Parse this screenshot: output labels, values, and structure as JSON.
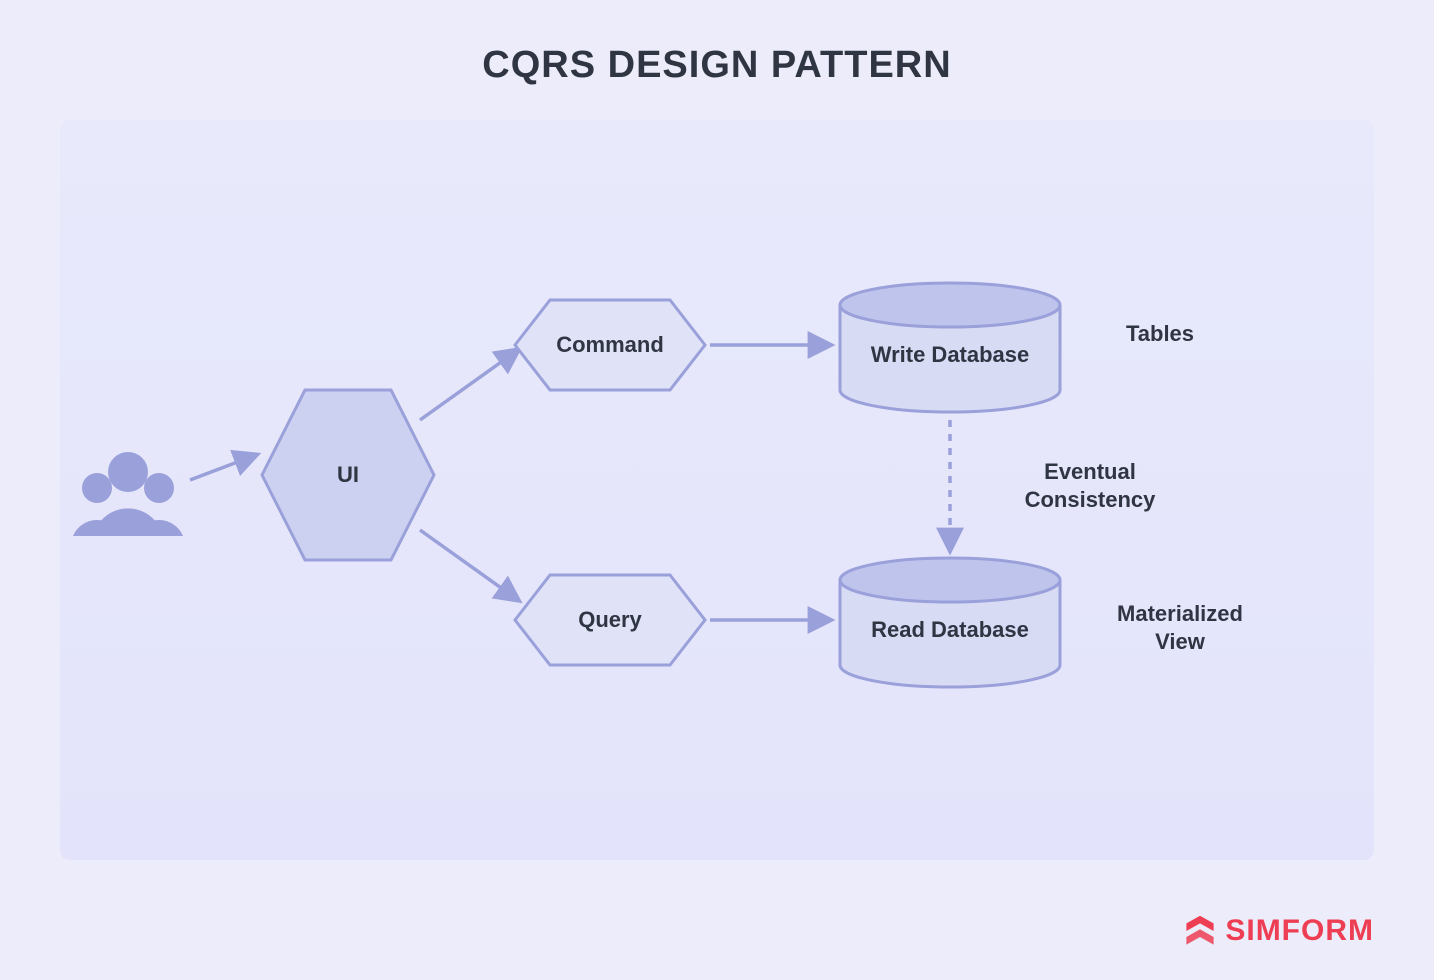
{
  "title": "CQRS DESIGN PATTERN",
  "nodes": {
    "ui": "UI",
    "command": "Command",
    "query": "Query",
    "write_db": "Write Database",
    "read_db": "Read Database"
  },
  "annotations": {
    "tables": "Tables",
    "eventual_line1": "Eventual",
    "eventual_line2": "Consistency",
    "mat_view_line1": "Materialized",
    "mat_view_line2": "View"
  },
  "brand": "SIMFORM",
  "colors": {
    "stroke": "#9AA0D9",
    "hex_fill": "#CDD1F1",
    "hex_light": "#E0E3F7",
    "db_top": "#BFC4ED",
    "db_body": "#D8DBF4",
    "text": "#2F3542",
    "brand": "#EE3E54"
  }
}
